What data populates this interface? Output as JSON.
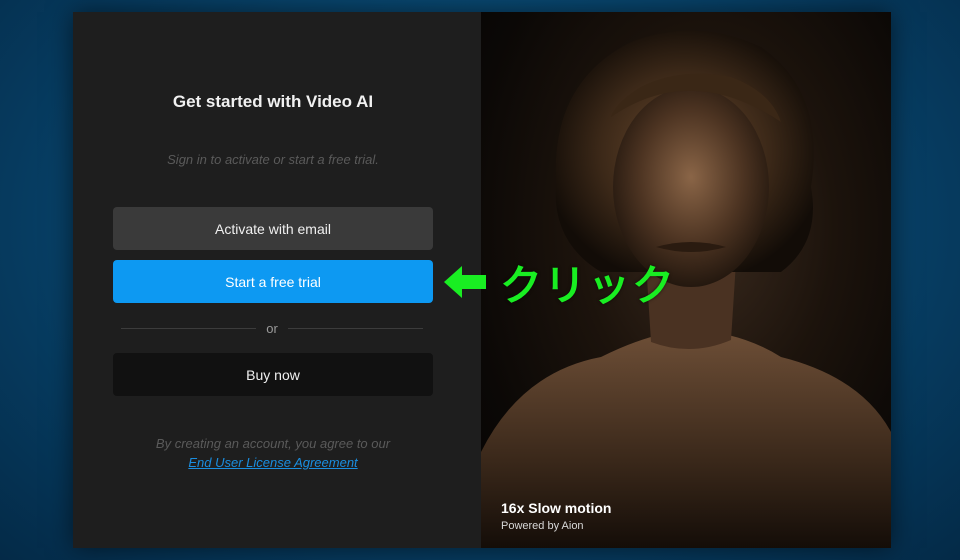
{
  "signin": {
    "title": "Get started with Video AI",
    "subtitle": "Sign in to activate or start a free trial.",
    "activate_label": "Activate with email",
    "trial_label": "Start a free trial",
    "divider_label": "or",
    "buy_label": "Buy now",
    "legal_text": "By creating an account, you agree to our",
    "eula_link": "End User License Agreement"
  },
  "preview": {
    "image_icon": "portrait-photo",
    "caption_title": "16x Slow motion",
    "caption_sub": "Powered by Aion"
  },
  "annotation": {
    "icon": "arrow-left-icon",
    "text": "クリック",
    "color": "#19ee22"
  },
  "colors": {
    "accent": "#0d99f2",
    "link": "#1a8ee0",
    "panel": "#1e1e1e"
  }
}
